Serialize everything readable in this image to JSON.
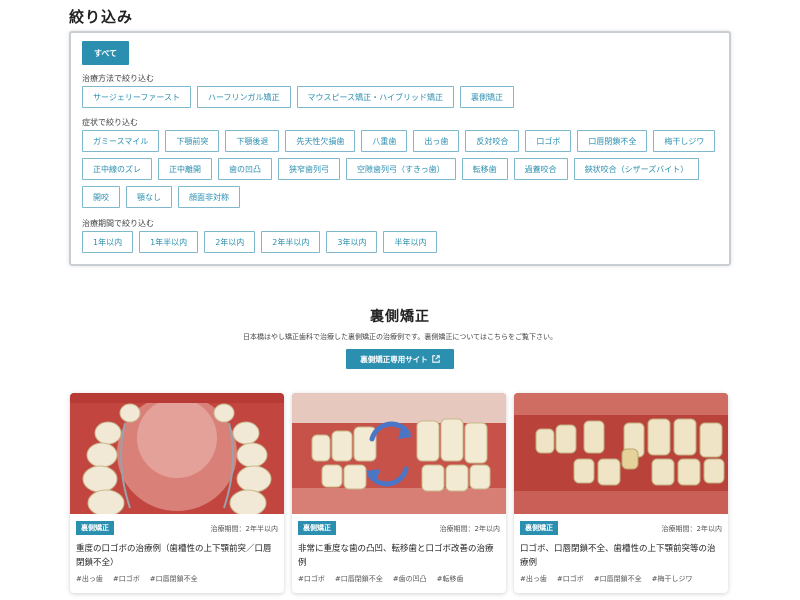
{
  "filter": {
    "title": "絞り込み",
    "all_label": "すべて",
    "method_label": "治療方法で絞り込む",
    "methods": [
      "サージェリーファースト",
      "ハーフリンガル矯正",
      "マウスピース矯正・ハイブリッド矯正",
      "裏側矯正"
    ],
    "symptom_label": "症状で絞り込む",
    "symptoms": [
      "ガミースマイル",
      "下顎前突",
      "下顎後退",
      "先天性欠損歯",
      "八重歯",
      "出っ歯",
      "反対咬合",
      "口ゴボ",
      "口唇閉鎖不全",
      "梅干しジワ",
      "正中線のズレ",
      "正中離開",
      "歯の凹凸",
      "狭窄歯列弓",
      "空隙歯列弓（すきっ歯）",
      "転移歯",
      "過蓋咬合",
      "鋏状咬合（シザーズバイト）",
      "開咬",
      "顎なし",
      "顔面非対称"
    ],
    "period_label": "治療期間で絞り込む",
    "periods": [
      "1年以内",
      "1年半以内",
      "2年以内",
      "2年半以内",
      "3年以内",
      "半年以内"
    ]
  },
  "section": {
    "title": "裏側矯正",
    "description": "日本橋はやし矯正歯科で治療した裏側矯正の治療例です。裏側矯正についてはこちらをご覧下さい。",
    "site_button": "裏側矯正専用サイト",
    "external_icon": "external-link-icon"
  },
  "cards": [
    {
      "badge": "裏側矯正",
      "period": "治療期間：2年半以内",
      "title": "重度の口ゴボの治療例（歯槽性の上下顎前突／口唇閉鎖不全）",
      "tags": [
        "#出っ歯",
        "#口ゴボ",
        "#口唇閉鎖不全"
      ]
    },
    {
      "badge": "裏側矯正",
      "period": "治療期間：2年以内",
      "title": "非常に重度な歯の凸凹、転移歯と口ゴボ改善の治療例",
      "tags": [
        "#口ゴボ",
        "#口唇閉鎖不全",
        "#歯の凹凸",
        "#転移歯"
      ]
    },
    {
      "badge": "裏側矯正",
      "period": "治療期間：2年以内",
      "title": "口ゴボ、口唇閉鎖不全、歯槽性の上下顎前突等の治療例",
      "tags": [
        "#出っ歯",
        "#口ゴボ",
        "#口唇閉鎖不全",
        "#梅干しジワ"
      ]
    }
  ],
  "colors": {
    "accent": "#2b8fb0",
    "chip_border": "#7fb8cc"
  }
}
